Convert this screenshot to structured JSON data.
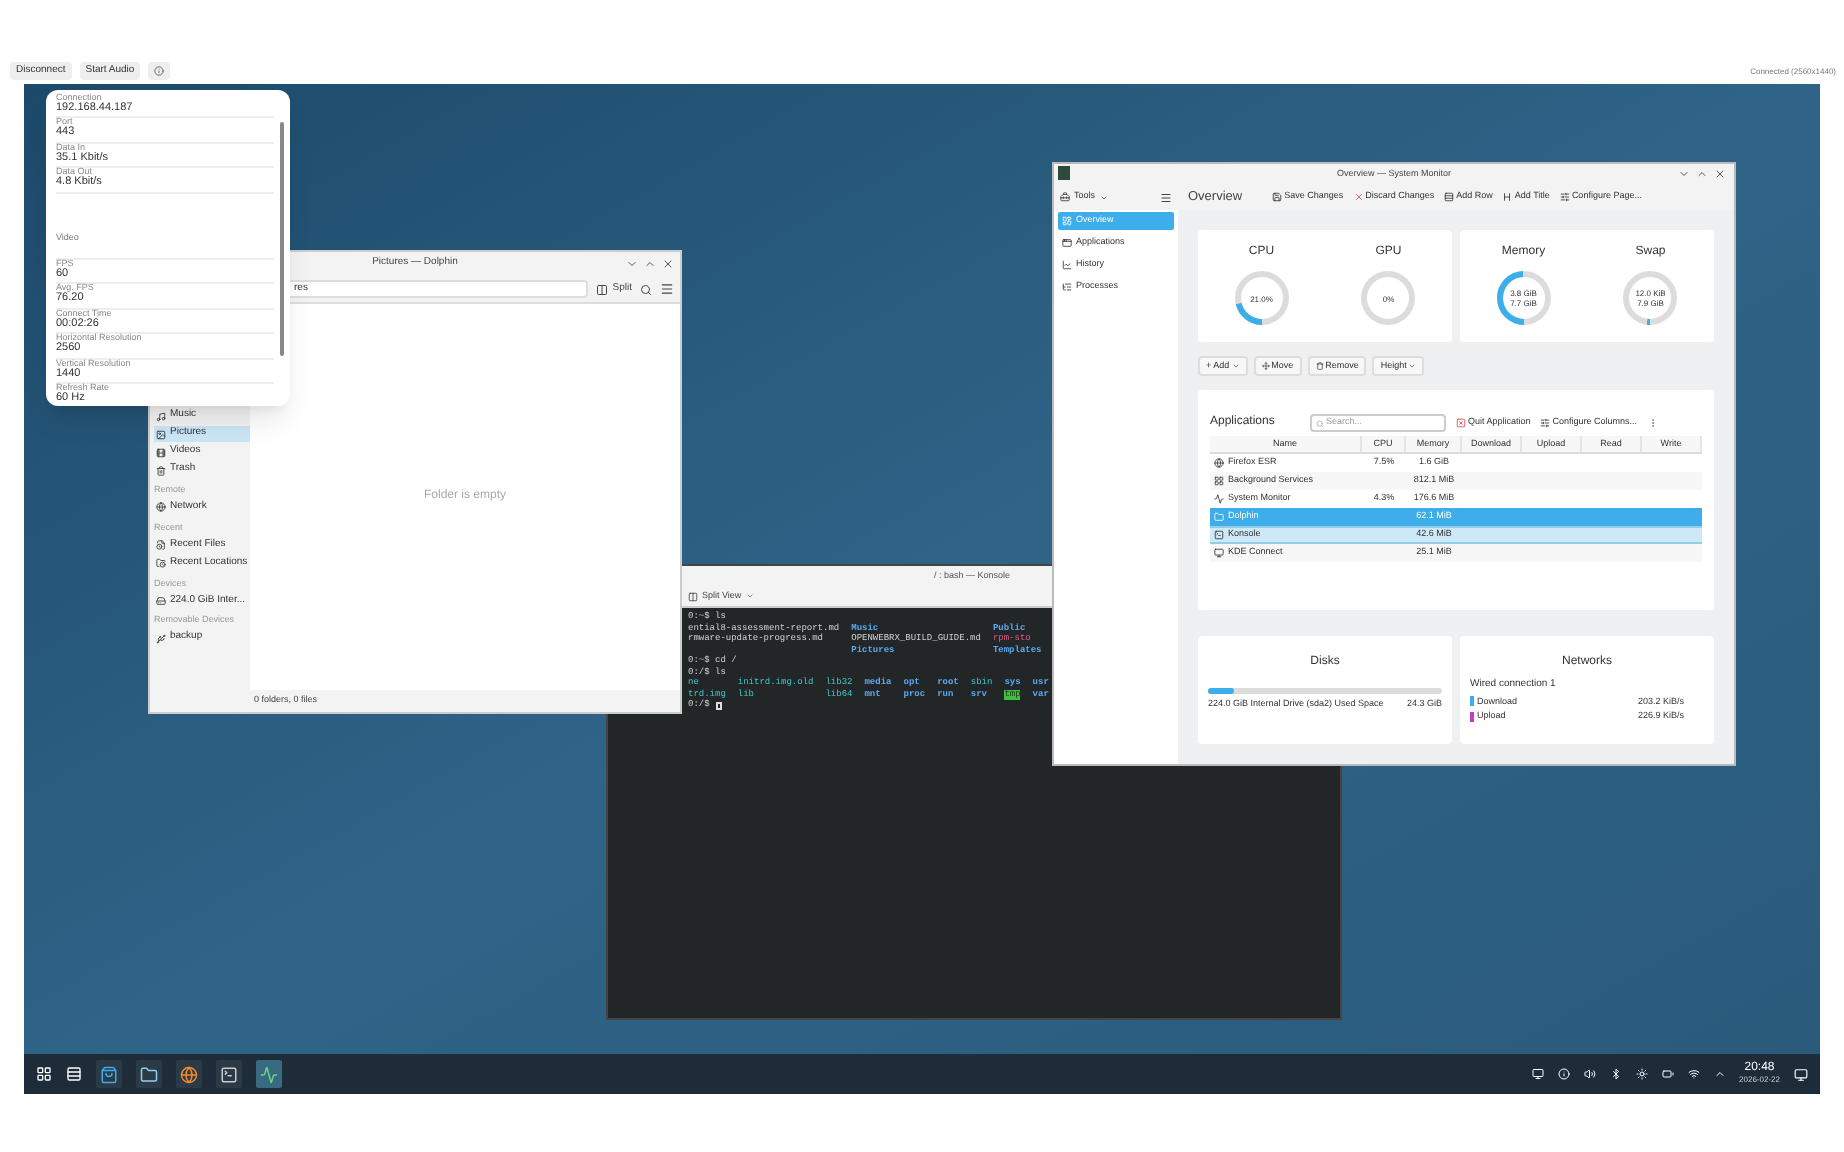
{
  "top_bar": {
    "buttons": [
      "Disconnect",
      "Start Audio"
    ],
    "status": "Connected (2560x1440)"
  },
  "stats_popup": {
    "items": [
      {
        "kind": "field",
        "label": "Connection",
        "value": "192.168.44.187"
      },
      {
        "kind": "field",
        "label": "Port",
        "value": "443"
      },
      {
        "kind": "field",
        "label": "Data In",
        "value": "35.1 Kbit/s"
      },
      {
        "kind": "field",
        "label": "Data Out",
        "value": "4.8 Kbit/s"
      },
      {
        "kind": "heading",
        "label": "Video"
      },
      {
        "kind": "field",
        "label": "FPS",
        "value": "60"
      },
      {
        "kind": "field",
        "label": "Avg. FPS",
        "value": "76.20"
      },
      {
        "kind": "field",
        "label": "Connect Time",
        "value": "00:02:26"
      },
      {
        "kind": "field",
        "label": "Horizontal Resolution",
        "value": "2560"
      },
      {
        "kind": "field",
        "label": "Vertical Resolution",
        "value": "1440"
      },
      {
        "kind": "field",
        "label": "Refresh Rate",
        "value": "60 Hz"
      }
    ]
  },
  "dolphin": {
    "title": "Pictures — Dolphin",
    "location": "res",
    "split_label": "Split",
    "empty_text": "Folder is empty",
    "status": "0 folders, 0 files",
    "sidebar": [
      {
        "kind": "place",
        "label": "Music",
        "selected": false
      },
      {
        "kind": "place",
        "label": "Pictures",
        "selected": true
      },
      {
        "kind": "place",
        "label": "Videos",
        "selected": false
      },
      {
        "kind": "place",
        "label": "Trash",
        "selected": false
      },
      {
        "kind": "section",
        "label": "Remote"
      },
      {
        "kind": "place",
        "label": "Network",
        "selected": false
      },
      {
        "kind": "section",
        "label": "Recent"
      },
      {
        "kind": "place",
        "label": "Recent Files",
        "selected": false
      },
      {
        "kind": "place",
        "label": "Recent Locations",
        "selected": false
      },
      {
        "kind": "section",
        "label": "Devices"
      },
      {
        "kind": "place",
        "label": "224.0 GiB Inter...",
        "selected": false
      },
      {
        "kind": "section",
        "label": "Removable Devices"
      },
      {
        "kind": "place",
        "label": "backup",
        "selected": false
      }
    ]
  },
  "konsole": {
    "title": "/ : bash — Konsole",
    "split_label": "Split View",
    "blocks": [
      {
        "kind": "prompt",
        "text": "0:~$ ls"
      },
      {
        "kind": "listing",
        "rows": [
          [
            {
              "kind": "file",
              "text": "ential8-assessment-report.md"
            },
            {
              "kind": "dir",
              "text": "Music"
            },
            {
              "kind": "dir",
              "text": "Public"
            }
          ],
          [
            {
              "kind": "file",
              "text": "rmware-update-progress.md"
            },
            {
              "kind": "file",
              "text": "OPENWEBRX_BUILD_GUIDE.md"
            },
            {
              "kind": "archive",
              "text": "rpm-sto"
            }
          ],
          [
            {
              "kind": "blank"
            },
            {
              "kind": "dir",
              "text": "Pictures"
            },
            {
              "kind": "dir",
              "text": "Templates"
            }
          ]
        ]
      },
      {
        "kind": "prompt",
        "text": "0:~$ cd /"
      },
      {
        "kind": "prompt",
        "text": "0:/$ ls"
      },
      {
        "kind": "listing",
        "rows": [
          [
            {
              "kind": "link",
              "text": "ne"
            },
            {
              "kind": "link",
              "text": "initrd.img.old"
            },
            {
              "kind": "link",
              "text": "lib32"
            },
            {
              "kind": "dir",
              "text": "media"
            },
            {
              "kind": "dir",
              "text": "opt"
            },
            {
              "kind": "dir",
              "text": "root"
            },
            {
              "kind": "link",
              "text": "sbin"
            },
            {
              "kind": "dir",
              "text": "sys"
            },
            {
              "kind": "dir",
              "text": "usr"
            }
          ],
          [
            {
              "kind": "link",
              "text": "trd.img"
            },
            {
              "kind": "link",
              "text": "lib"
            },
            {
              "kind": "link",
              "text": "lib64"
            },
            {
              "kind": "dir",
              "text": "mnt"
            },
            {
              "kind": "dir",
              "text": "proc"
            },
            {
              "kind": "dir",
              "text": "run"
            },
            {
              "kind": "dir",
              "text": "srv"
            },
            {
              "kind": "sticky",
              "text": "tmp"
            },
            {
              "kind": "dir",
              "text": "var"
            }
          ]
        ]
      },
      {
        "kind": "prompt",
        "text": "0:/$ ",
        "cursor": true
      }
    ]
  },
  "system_monitor": {
    "title": "Overview — System Monitor",
    "tools_label": "Tools",
    "page_title": "Overview",
    "toolbar": [
      "Save Changes",
      "Discard Changes",
      "Add Row",
      "Add Title",
      "Configure Page..."
    ],
    "sidebar": [
      {
        "label": "Overview",
        "selected": true
      },
      {
        "label": "Applications",
        "selected": false
      },
      {
        "label": "History",
        "selected": false
      },
      {
        "label": "Processes",
        "selected": false
      }
    ],
    "gauges": [
      {
        "title": "CPU",
        "lines": [
          "21.0%"
        ],
        "level": 0.21
      },
      {
        "title": "GPU",
        "lines": [
          "0%"
        ],
        "level": 0
      },
      {
        "title": "Memory",
        "lines": [
          "3.8 GiB",
          "7.7 GiB"
        ],
        "level": 0.49
      },
      {
        "title": "Swap",
        "lines": [
          "12.0 KiB",
          "7.9 GiB"
        ],
        "level": 0.02
      }
    ],
    "edit_buttons": [
      "+ Add",
      "Move",
      "Remove",
      "Height"
    ],
    "applications": {
      "title": "Applications",
      "search_placeholder": "Search...",
      "actions": [
        "Quit Application",
        "Configure Columns..."
      ],
      "columns": [
        "Name",
        "CPU",
        "Memory",
        "Download",
        "Upload",
        "Read",
        "Write"
      ],
      "rows": [
        {
          "name": "Firefox ESR",
          "cpu": "7.5%",
          "memory": "1.6 GiB",
          "selected": false,
          "hover": false
        },
        {
          "name": "Background Services",
          "cpu": "",
          "memory": "812.1 MiB",
          "selected": false,
          "hover": false
        },
        {
          "name": "System Monitor",
          "cpu": "4.3%",
          "memory": "176.6 MiB",
          "selected": false,
          "hover": false
        },
        {
          "name": "Dolphin",
          "cpu": "",
          "memory": "62.1 MiB",
          "selected": true,
          "hover": false
        },
        {
          "name": "Konsole",
          "cpu": "",
          "memory": "42.6 MiB",
          "selected": false,
          "hover": true
        },
        {
          "name": "KDE Connect",
          "cpu": "",
          "memory": "25.1 MiB",
          "selected": false,
          "hover": false
        }
      ]
    },
    "disks": {
      "title": "Disks",
      "level": 0.11,
      "label": "224.0 GiB Internal Drive (sda2) Used Space",
      "value": "24.3 GiB"
    },
    "networks": {
      "title": "Networks",
      "connection": "Wired connection 1",
      "rows": [
        {
          "label": "Download",
          "value": "203.2 KiB/s",
          "color": "#3daee9"
        },
        {
          "label": "Upload",
          "value": "226.9 KiB/s",
          "color": "#c03fc8"
        }
      ]
    }
  },
  "taskbar": {
    "clock": "20:48",
    "date": "2026-02-22"
  }
}
